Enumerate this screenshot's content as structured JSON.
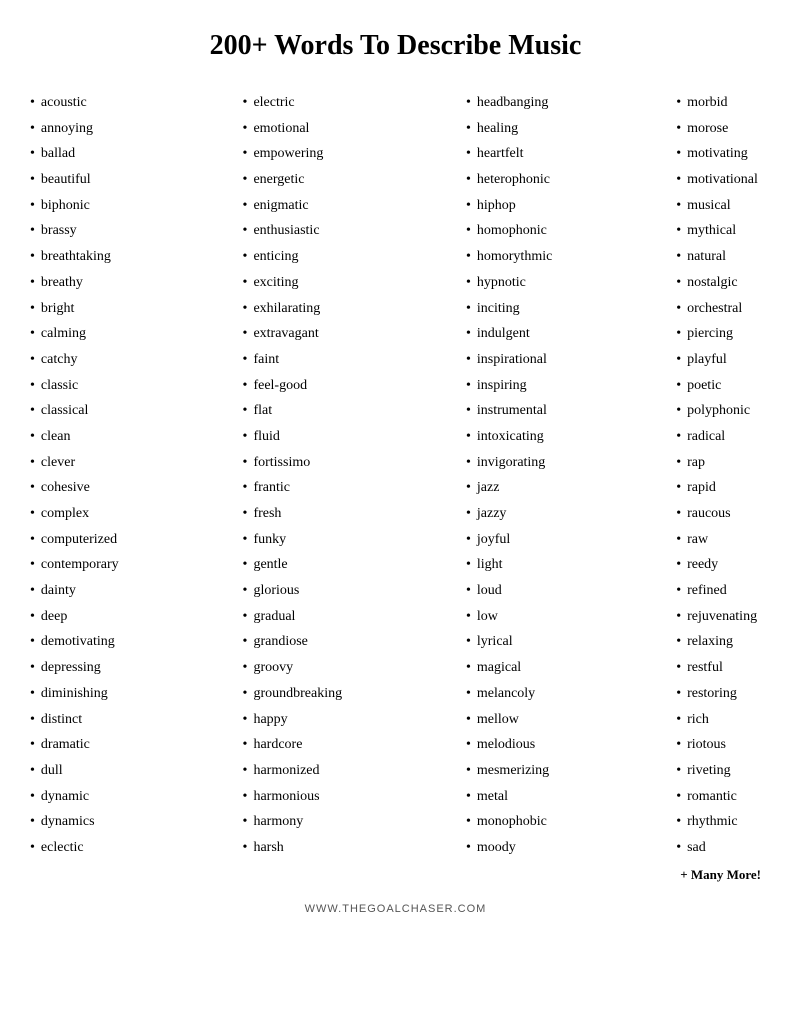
{
  "title": "200+ Words To Describe Music",
  "footer": "WWW.THEGOALCHASER.COM",
  "more_label": "+ Many More!",
  "columns": [
    {
      "id": "col1",
      "words": [
        "acoustic",
        "annoying",
        "ballad",
        "beautiful",
        "biphonic",
        "brassy",
        "breathtaking",
        "breathy",
        "bright",
        "calming",
        "catchy",
        "classic",
        "classical",
        "clean",
        "clever",
        "cohesive",
        "complex",
        "computerized",
        "contemporary",
        "dainty",
        "deep",
        "demotivating",
        "depressing",
        "diminishing",
        "distinct",
        "dramatic",
        "dull",
        "dynamic",
        "dynamics",
        "eclectic"
      ]
    },
    {
      "id": "col2",
      "words": [
        "electric",
        "emotional",
        "empowering",
        "energetic",
        "enigmatic",
        "enthusiastic",
        "enticing",
        "exciting",
        "exhilarating",
        "extravagant",
        "faint",
        "feel-good",
        "flat",
        "fluid",
        "fortissimo",
        "frantic",
        "fresh",
        "funky",
        "gentle",
        "glorious",
        "gradual",
        "grandiose",
        "groovy",
        "groundbreaking",
        "happy",
        "hardcore",
        "harmonized",
        "harmonious",
        "harmony",
        "harsh"
      ]
    },
    {
      "id": "col3",
      "words": [
        "headbanging",
        "healing",
        "heartfelt",
        "heterophonic",
        "hiphop",
        "homophonic",
        "homorythmic",
        "hypnotic",
        "inciting",
        "indulgent",
        "inspirational",
        "inspiring",
        "instrumental",
        "intoxicating",
        "invigorating",
        "jazz",
        "jazzy",
        "joyful",
        "light",
        "loud",
        "low",
        "lyrical",
        "magical",
        "melancoly",
        "mellow",
        "melodious",
        "mesmerizing",
        "metal",
        "monophobic",
        "moody"
      ]
    },
    {
      "id": "col4",
      "words": [
        "morbid",
        "morose",
        "motivating",
        "motivational",
        "musical",
        "mythical",
        "natural",
        "nostalgic",
        "orchestral",
        "piercing",
        "playful",
        "poetic",
        "polyphonic",
        "radical",
        "rap",
        "rapid",
        "raucous",
        "raw",
        "reedy",
        "refined",
        "rejuvenating",
        "relaxing",
        "restful",
        "restoring",
        "rich",
        "riotous",
        "riveting",
        "romantic",
        "rhythmic",
        "sad"
      ]
    }
  ]
}
